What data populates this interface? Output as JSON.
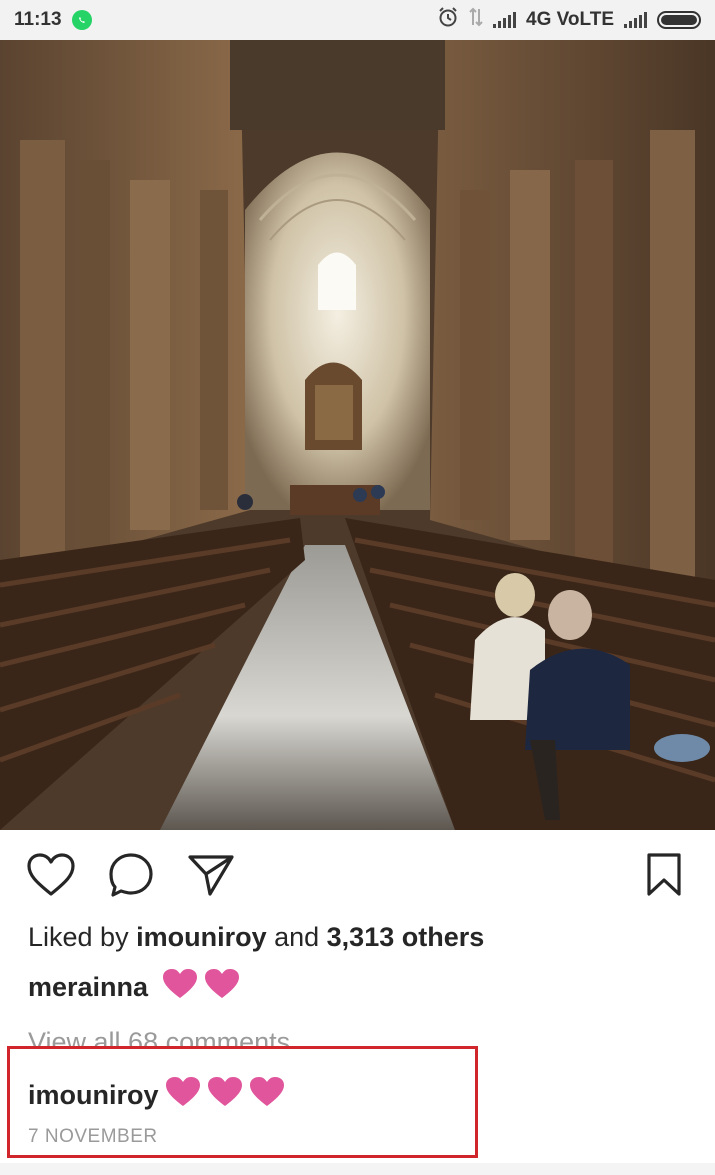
{
  "status_bar": {
    "time": "11:13",
    "network_label": "4G VoLTE"
  },
  "post": {
    "image_alt": "Cathedral interior with pews and two people seated",
    "likes_prefix": "Liked by ",
    "liked_by_user": "imouniroy",
    "likes_and": " and ",
    "likes_others": "3,313 others",
    "caption_user": "merainna",
    "caption_hearts": 2,
    "view_comments": "View all 68 comments",
    "comment_user": "imouniroy",
    "comment_hearts": 3,
    "date": "7 NOVEMBER"
  },
  "icons": {
    "like": "heart-outline-icon",
    "comment": "comment-bubble-icon",
    "share": "paper-plane-icon",
    "save": "bookmark-icon",
    "emoji_heart": "pink-heart-emoji"
  },
  "colors": {
    "heart_emoji": "#e0559b",
    "highlight_box": "#d0262b",
    "muted_text": "#9a9a9a",
    "whatsapp": "#25d366"
  }
}
